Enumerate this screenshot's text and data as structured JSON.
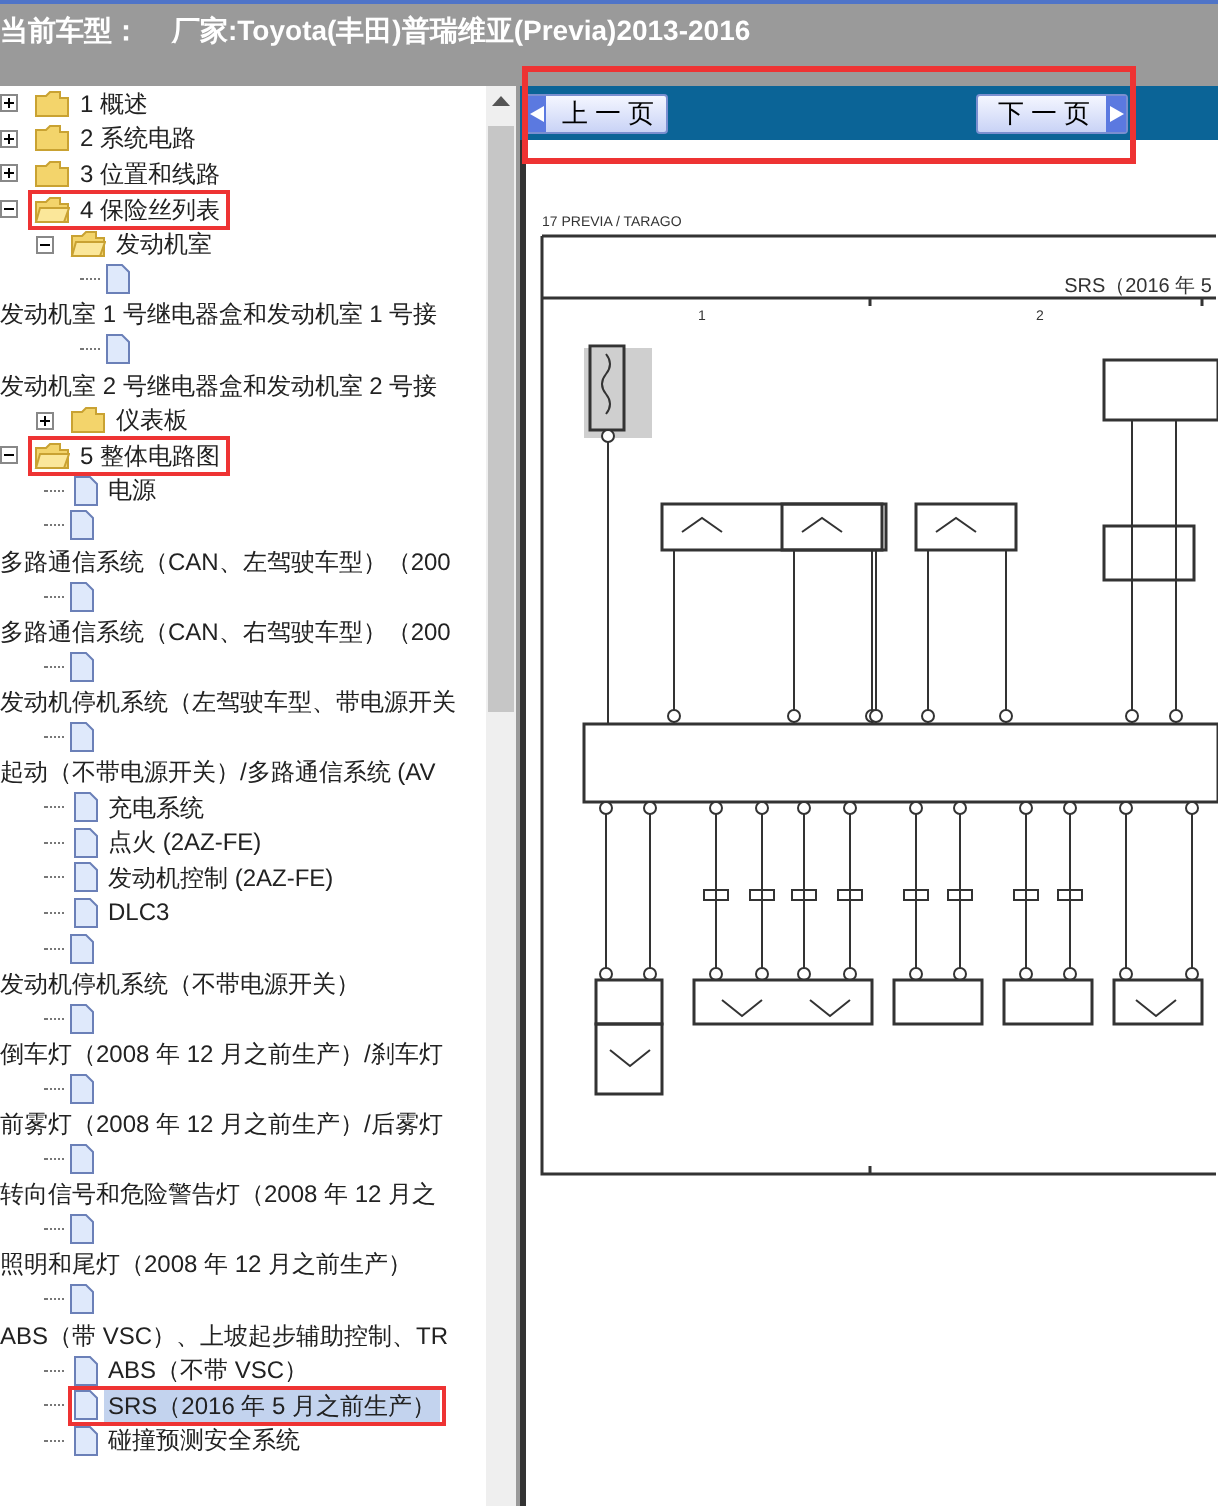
{
  "title_bar": {
    "label": "当前车型：",
    "value": "厂家:Toyota(丰田)普瑞维亚(Previa)2013-2016"
  },
  "tree": [
    {
      "kind": "folder",
      "label": "1 概述",
      "expanded": false,
      "selected": false,
      "marked": false
    },
    {
      "kind": "folder",
      "label": "2 系统电路",
      "expanded": false,
      "selected": false,
      "marked": false
    },
    {
      "kind": "folder",
      "label": "3 位置和线路",
      "expanded": false,
      "selected": false,
      "marked": false
    },
    {
      "kind": "folder",
      "label": "4 保险丝列表",
      "expanded": true,
      "selected": false,
      "marked": true,
      "children": [
        {
          "kind": "folder",
          "label": "发动机室",
          "expanded": true,
          "selected": false,
          "marked": false,
          "children": [
            {
              "kind": "doc-below",
              "label": "发动机室 1 号继电器盒和发动机室 1 号接",
              "selected": false,
              "marked": false
            },
            {
              "kind": "doc-below",
              "label": "发动机室 2 号继电器盒和发动机室 2 号接",
              "selected": false,
              "marked": false
            }
          ]
        },
        {
          "kind": "folder",
          "label": "仪表板",
          "expanded": false,
          "selected": false,
          "marked": false
        }
      ]
    },
    {
      "kind": "folder",
      "label": "5 整体电路图",
      "expanded": true,
      "selected": false,
      "marked": true,
      "children": [
        {
          "kind": "doc",
          "label": "电源",
          "selected": false,
          "marked": false
        },
        {
          "kind": "doc-below",
          "label": "多路通信系统（CAN、左驾驶车型）（200",
          "selected": false,
          "marked": false
        },
        {
          "kind": "doc-below",
          "label": "多路通信系统（CAN、右驾驶车型）（200",
          "selected": false,
          "marked": false
        },
        {
          "kind": "doc-below",
          "label": "发动机停机系统（左驾驶车型、带电源开关",
          "selected": false,
          "marked": false
        },
        {
          "kind": "doc-below",
          "label": "起动（不带电源开关）/多路通信系统 (AV",
          "selected": false,
          "marked": false
        },
        {
          "kind": "doc",
          "label": "充电系统",
          "selected": false,
          "marked": false
        },
        {
          "kind": "doc",
          "label": "点火 (2AZ-FE)",
          "selected": false,
          "marked": false
        },
        {
          "kind": "doc",
          "label": "发动机控制 (2AZ-FE)",
          "selected": false,
          "marked": false
        },
        {
          "kind": "doc",
          "label": "DLC3",
          "selected": false,
          "marked": false
        },
        {
          "kind": "doc-below",
          "label": "发动机停机系统（不带电源开关）",
          "selected": false,
          "marked": false
        },
        {
          "kind": "doc-below",
          "label": "倒车灯（2008 年 12 月之前生产）/刹车灯",
          "selected": false,
          "marked": false
        },
        {
          "kind": "doc-below",
          "label": "前雾灯（2008 年 12 月之前生产）/后雾灯",
          "selected": false,
          "marked": false
        },
        {
          "kind": "doc-below",
          "label": "转向信号和危险警告灯（2008 年 12 月之",
          "selected": false,
          "marked": false
        },
        {
          "kind": "doc-below",
          "label": "照明和尾灯（2008 年 12 月之前生产）",
          "selected": false,
          "marked": false
        },
        {
          "kind": "doc-below",
          "label": "ABS（带 VSC）、上坡起步辅助控制、TR",
          "selected": false,
          "marked": false
        },
        {
          "kind": "doc",
          "label": "ABS（不带 VSC）",
          "selected": false,
          "marked": false
        },
        {
          "kind": "doc",
          "label": "SRS（2016 年 5 月之前生产）",
          "selected": true,
          "marked": true
        },
        {
          "kind": "doc",
          "label": "碰撞预测安全系统",
          "selected": false,
          "marked": false
        }
      ]
    }
  ],
  "nav": {
    "prev": "上 一 页",
    "next": "下 一 页",
    "marked": true
  },
  "diagram": {
    "page_header": "17 PREVIA / TARAGO",
    "title": "SRS（2016 年 5",
    "columns": [
      "1",
      "2"
    ]
  }
}
